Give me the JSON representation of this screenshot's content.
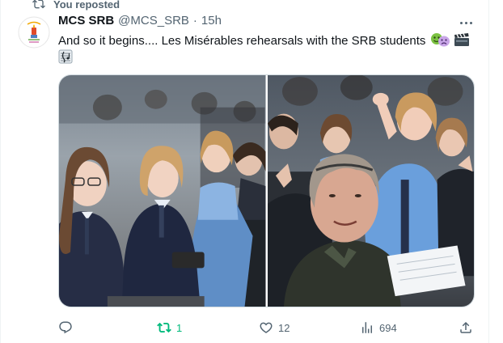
{
  "repost_banner": {
    "label": "You reposted",
    "icon": "repost-icon"
  },
  "tweet": {
    "author_name": "MCS SRB",
    "author_handle": "@MCS_SRB",
    "separator": "·",
    "timestamp": "15h",
    "text": "And so it begins.... Les Misérables rehearsals with the SRB students",
    "emojis": [
      "performing-arts-icon",
      "clapper-board-icon",
      "musical-score-icon"
    ],
    "media": [
      {
        "name": "photo-students-row"
      },
      {
        "name": "photo-group-selfie"
      }
    ],
    "actions": {
      "reply": {
        "icon": "reply-icon",
        "count": ""
      },
      "repost": {
        "icon": "repost-icon",
        "count": "1",
        "active": true,
        "color": "#00ba7c"
      },
      "like": {
        "icon": "heart-icon",
        "count": "12"
      },
      "views": {
        "icon": "views-icon",
        "count": "694"
      },
      "share": {
        "icon": "share-icon"
      }
    }
  },
  "colors": {
    "text": "#0f1419",
    "secondary": "#536471",
    "border": "#cfd9de",
    "repost_green": "#00ba7c"
  }
}
